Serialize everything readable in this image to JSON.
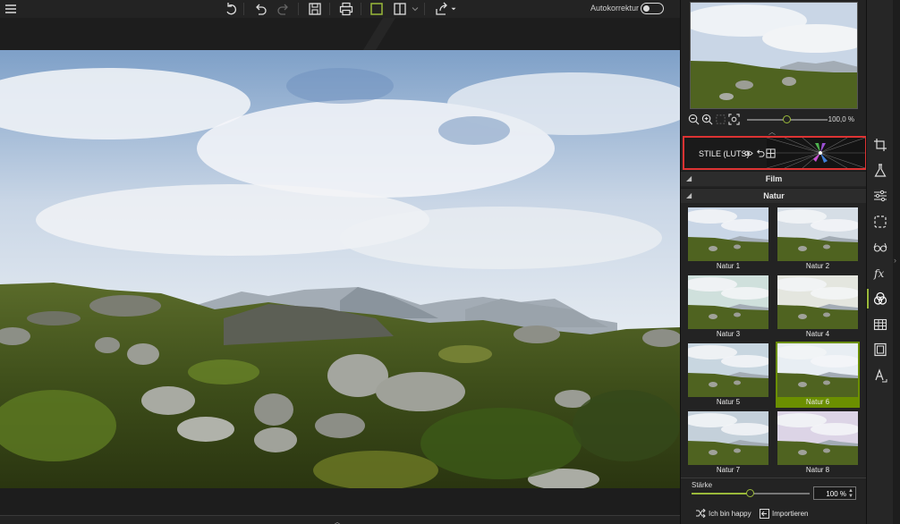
{
  "toolbar": {
    "autokorrektur_label": "Autokorrektur",
    "autokorrektur_on": false
  },
  "navigator": {
    "zoom_value": "100,0 %"
  },
  "styles_header": {
    "label": "STILE (LUTS)"
  },
  "sections": [
    {
      "label": "Film",
      "collapsed": true
    },
    {
      "label": "Natur",
      "collapsed": false
    }
  ],
  "presets": [
    {
      "label": "Natur 1",
      "selected": false
    },
    {
      "label": "Natur 2",
      "selected": false
    },
    {
      "label": "Natur 3",
      "selected": false
    },
    {
      "label": "Natur 4",
      "selected": false
    },
    {
      "label": "Natur 5",
      "selected": false
    },
    {
      "label": "Natur 6",
      "selected": true
    },
    {
      "label": "Natur 7",
      "selected": false
    },
    {
      "label": "Natur 8",
      "selected": false
    }
  ],
  "strength": {
    "label": "Stärke",
    "value": "100 %",
    "level": 0.5
  },
  "actions": {
    "happy": "Ich bin happy",
    "import": "Importieren"
  },
  "colors": {
    "accent": "#9ab93a",
    "selection": "#6b8f00",
    "highlight_border": "#dd3333"
  }
}
